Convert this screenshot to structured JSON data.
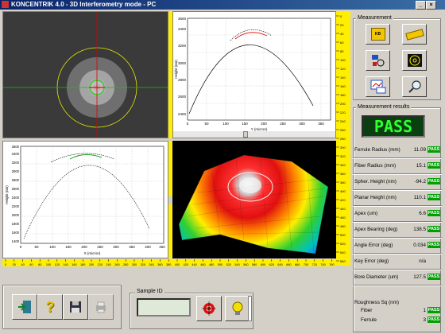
{
  "window": {
    "title": "KONCENTRIK 4.0 - 3D Interferometry mode - PC"
  },
  "profile_top": {
    "xlabel": "Y (micron)",
    "ylabel": "Height (nm)",
    "xticks": [
      "0",
      "50",
      "100",
      "150",
      "200",
      "250",
      "300",
      "350"
    ],
    "yticks": [
      "2400",
      "2600",
      "2800",
      "3000",
      "3200",
      "3400",
      "3600"
    ]
  },
  "profile_left": {
    "xlabel": "X (micron)",
    "ylabel": "Height (nm)",
    "xticks": [
      "0",
      "50",
      "100",
      "150",
      "200",
      "250",
      "300",
      "350",
      "400",
      "450"
    ],
    "yticks": [
      "1400",
      "1600",
      "1800",
      "2000",
      "2200",
      "2400",
      "2600",
      "2800",
      "3000",
      "3200",
      "3400",
      "3600"
    ]
  },
  "ruler_v_ticks": [
    "0",
    "20",
    "40",
    "60",
    "80",
    "100",
    "120",
    "140",
    "160",
    "180",
    "200",
    "220",
    "240",
    "260",
    "280",
    "300",
    "320",
    "340",
    "360",
    "380",
    "400",
    "420",
    "440",
    "460",
    "480",
    "500",
    "520",
    "540",
    "560"
  ],
  "ruler_h_ticks": [
    "0",
    "20",
    "40",
    "60",
    "80",
    "100",
    "120",
    "140",
    "160",
    "180",
    "200",
    "220",
    "240",
    "260",
    "280",
    "300",
    "320",
    "340",
    "360",
    "380",
    "400",
    "420",
    "440",
    "460",
    "480",
    "500",
    "520",
    "540",
    "560",
    "580",
    "600",
    "620",
    "640",
    "660",
    "680",
    "700",
    "720",
    "740",
    "760"
  ],
  "measurement": {
    "title": "Measurement"
  },
  "results": {
    "title": "Measurement results",
    "status": "PASS",
    "rows": [
      {
        "label": "Ferrule Radius (mm)",
        "value": "11.09",
        "badge": "PASS"
      },
      {
        "label": "Fiber Radius (mm)",
        "value": "15.1",
        "badge": "PASS"
      },
      {
        "label": "Spher. Height (nm)",
        "value": "-94.2",
        "badge": "PASS"
      },
      {
        "label": "Planar Height (nm)",
        "value": "110.1",
        "badge": "PASS"
      },
      {
        "label": "Apex (um)",
        "value": "6.6",
        "badge": "PASS"
      },
      {
        "label": "Apex Bearing (deg)",
        "value": "138.5",
        "badge": "PASS"
      },
      {
        "label": "Angle Error (deg)",
        "value": "0.034",
        "badge": "PASS"
      },
      {
        "label": "Key Error (deg)",
        "value": "n/a",
        "badge": ""
      },
      {
        "label": "Bore Diameter (um)",
        "value": "127.5",
        "badge": "PASS"
      }
    ],
    "roughness": {
      "title": "Roughness Sq (nm)",
      "fiber_label": "Fiber",
      "fiber_value": "1",
      "fiber_badge": "PASS",
      "ferrule_label": "Ferrule",
      "ferrule_value": "3",
      "ferrule_badge": "PASS"
    }
  },
  "sample": {
    "label": "Sample ID",
    "value": ""
  },
  "icons": [
    "exit-icon",
    "help-icon",
    "save-icon",
    "print-icon",
    "record-icon",
    "lamp-icon",
    "kb-icon",
    "ruler-icon",
    "camera-icon",
    "target-icon",
    "graph-icon",
    "magnifier-icon"
  ],
  "colors": {
    "accent_yellow": "#ffee00",
    "pass_green": "#00a000",
    "status_bg": "#0a4010",
    "status_fg": "#30ff30"
  }
}
